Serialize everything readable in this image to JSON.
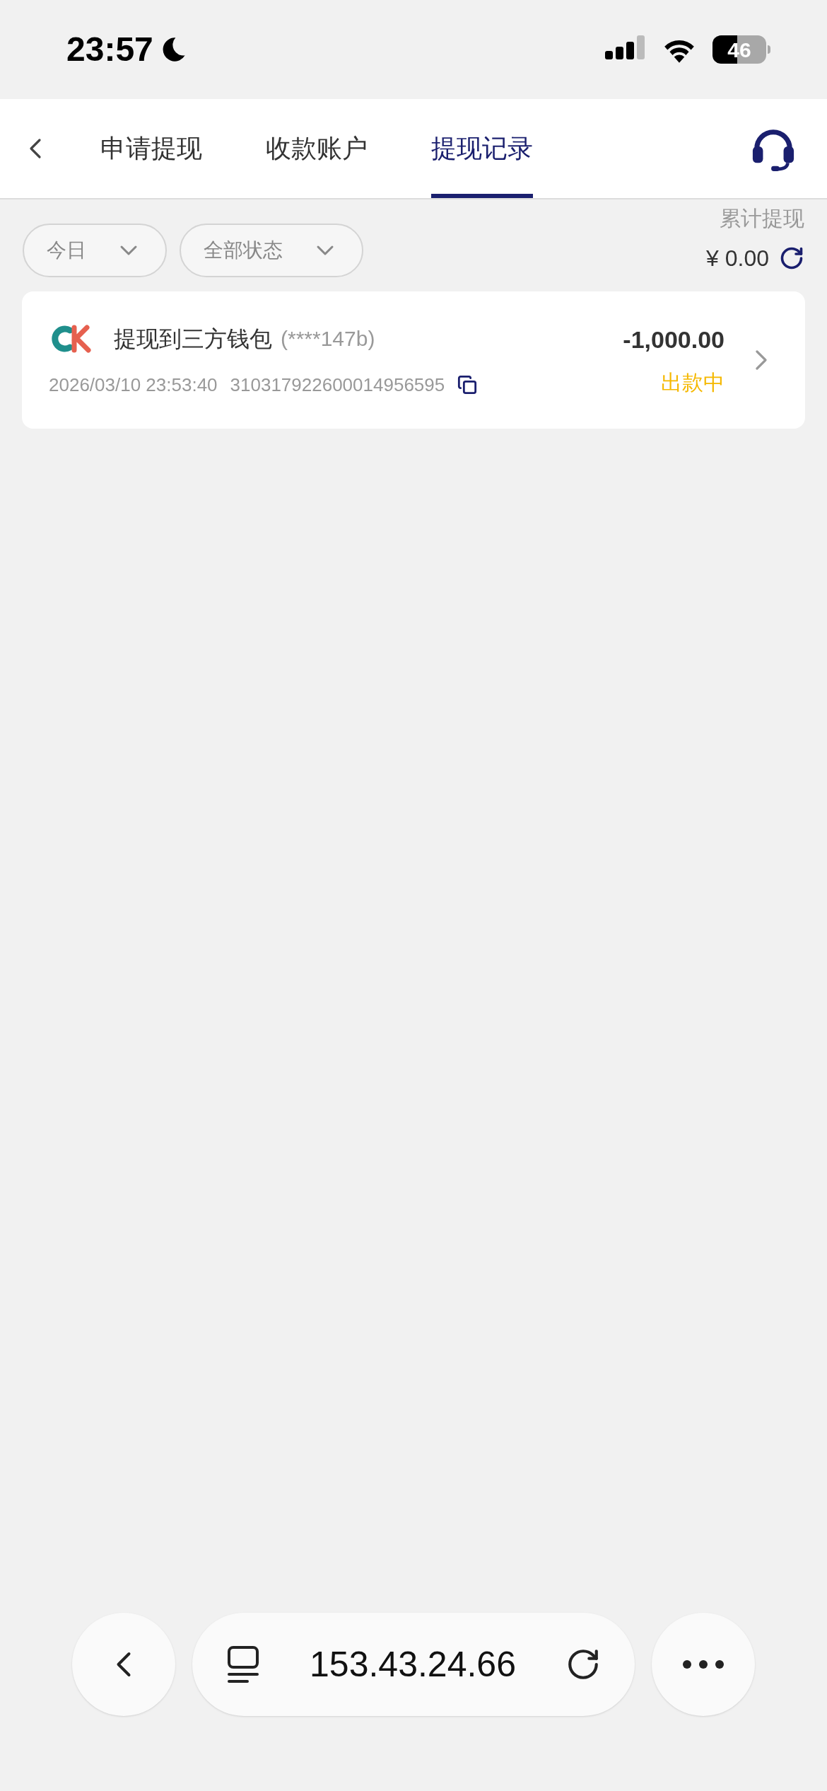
{
  "status_bar": {
    "time": "23:57",
    "battery": "46"
  },
  "tabs": [
    {
      "label": "申请提现",
      "selected": false
    },
    {
      "label": "收款账户",
      "selected": false
    },
    {
      "label": "提现记录",
      "selected": true
    }
  ],
  "filters": [
    {
      "label": "今日"
    },
    {
      "label": "全部状态"
    }
  ],
  "summary": {
    "label": "累计提现",
    "amount": "¥ 0.00"
  },
  "records": [
    {
      "title": "提现到三方钱包",
      "account": "(****147b)",
      "time": "2026/03/10 23:53:40",
      "order_no": "310317922600014956595",
      "amount": "-1,000.00",
      "status": "出款中"
    }
  ],
  "browser_bar": {
    "url": "153.43.24.66"
  }
}
